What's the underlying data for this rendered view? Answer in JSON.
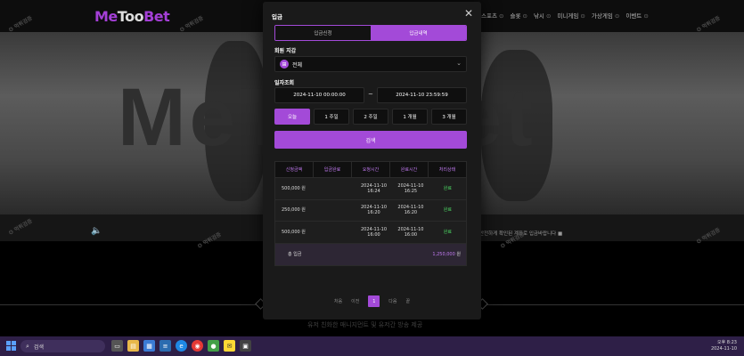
{
  "site": {
    "logo_prefix": "Me",
    "logo_too": "Too",
    "logo_suffix": "Bet",
    "hero_text": "MeTooBet",
    "watermark": "먹튀검증",
    "nav": [
      "스포츠",
      "슬롯",
      "낚시",
      "미니게임",
      "가상게임",
      "이벤트"
    ],
    "notice": "안전하게 확인된 계좌로 입금바랍니다 ■",
    "bottom_text": "유저 친화한 매니지먼트 및 유저간 방송 제공"
  },
  "modal": {
    "title": "입금",
    "close_icon": "close-icon",
    "tabs": [
      {
        "label": "입금신청",
        "active": false
      },
      {
        "label": "입금내역",
        "active": true
      }
    ],
    "wallet_label": "회원 지갑",
    "wallet_value": "전체",
    "date_label": "일자조회",
    "date_from": "2024-11-10 00:00:00",
    "date_sep": "~",
    "date_to": "2024-11-10 23:59:59",
    "quick_ranges": [
      {
        "label": "오늘",
        "active": true
      },
      {
        "label": "1 주일",
        "active": false
      },
      {
        "label": "2 주일",
        "active": false
      },
      {
        "label": "1 개월",
        "active": false
      },
      {
        "label": "3 개월",
        "active": false
      }
    ],
    "search_label": "검색",
    "table": {
      "headers": [
        "신청금액",
        "입금완료",
        "요청시간",
        "완료시간",
        "처리상태"
      ],
      "rows": [
        {
          "amount": "500,000 원",
          "done": "",
          "req": "2024-11-10\n16:24",
          "fin": "2024-11-10\n16:25",
          "status": "완료"
        },
        {
          "amount": "250,000 원",
          "done": "",
          "req": "2024-11-10\n16:20",
          "fin": "2024-11-10\n16:20",
          "status": "완료"
        },
        {
          "amount": "500,000 원",
          "done": "",
          "req": "2024-11-10\n16:00",
          "fin": "2024-11-10\n16:00",
          "status": "완료"
        }
      ],
      "total_label": "총 입금",
      "total_value": "1,250,000",
      "total_unit": "원"
    },
    "pager": {
      "first": "처음",
      "prev": "이전",
      "current": "1",
      "next": "다음",
      "last": "끝"
    }
  },
  "taskbar": {
    "search_placeholder": "검색",
    "time": "오후 8:23",
    "date": "2024-11-10"
  },
  "colors": {
    "accent": "#a34ad8",
    "status_done": "#4cd964",
    "taskbar": "#2e1f47"
  }
}
